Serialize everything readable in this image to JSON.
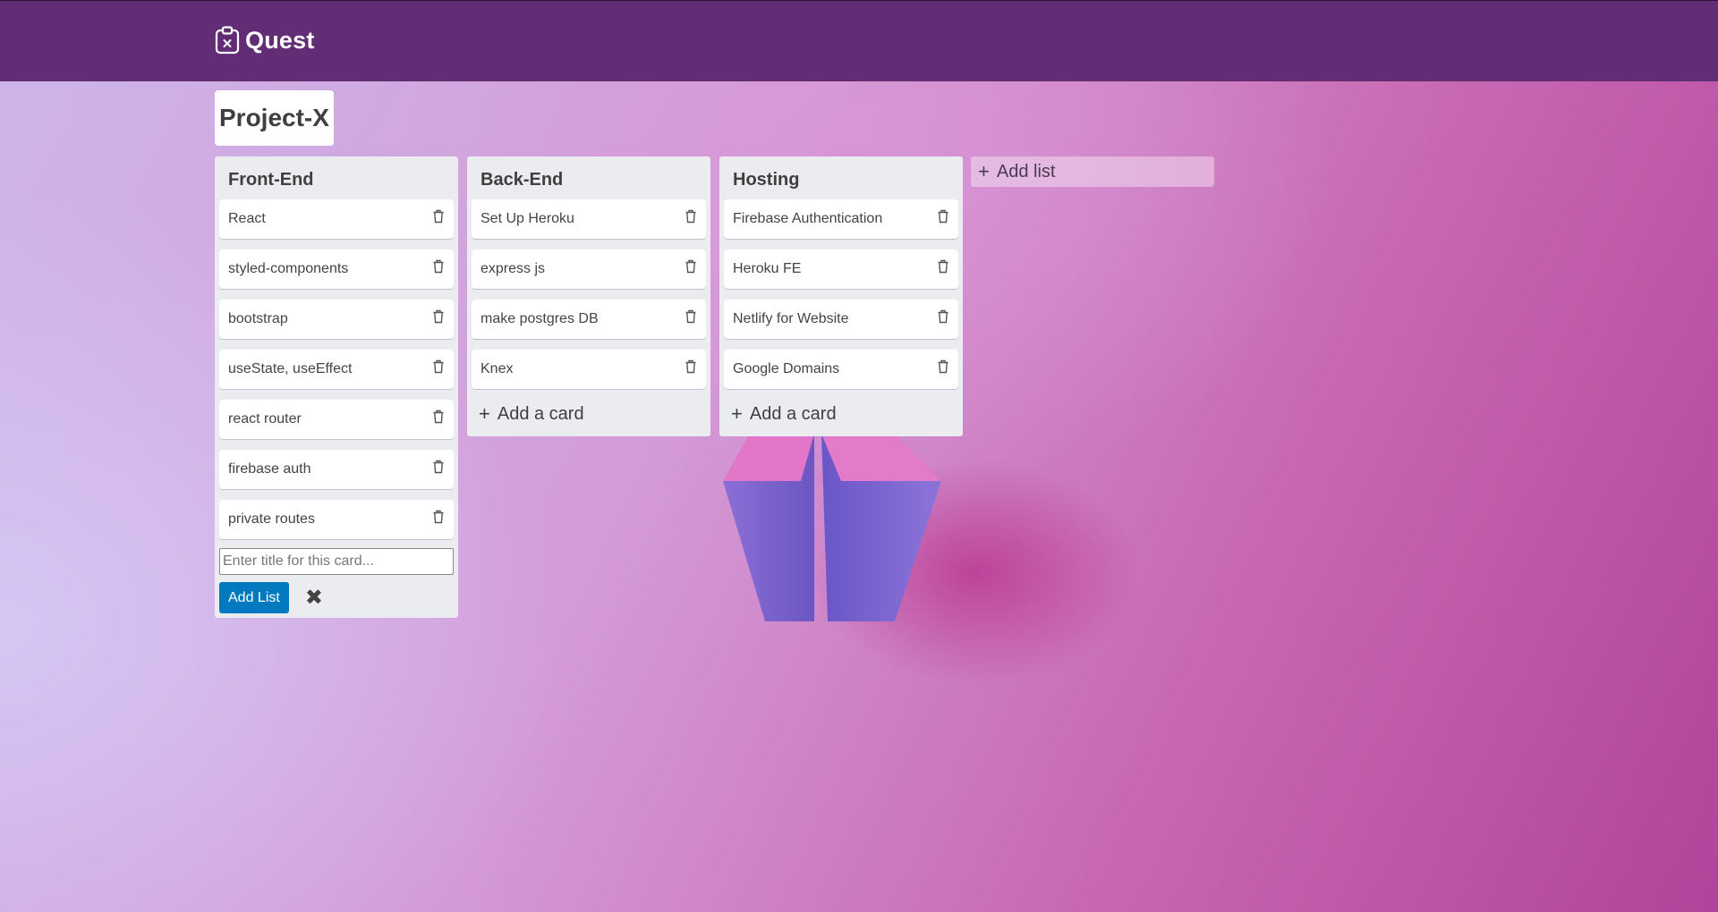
{
  "app": {
    "name": "Quest",
    "logo_icon": "clipboard-x-icon"
  },
  "board": {
    "title": "Project-X"
  },
  "lists": [
    {
      "title": "Front-End",
      "cards": [
        "React",
        "styled-components",
        "bootstrap",
        "useState, useEffect",
        "react router",
        "firebase auth",
        "private routes"
      ],
      "composer": {
        "placeholder": "Enter title for this card...",
        "value": "",
        "submit_label": "Add List",
        "close_icon": "close-icon"
      }
    },
    {
      "title": "Back-End",
      "cards": [
        "Set Up Heroku",
        "express js",
        "make postgres DB",
        "Knex"
      ],
      "add_card_label": "Add a card"
    },
    {
      "title": "Hosting",
      "cards": [
        "Firebase Authentication",
        "Heroku FE",
        "Netlify for Website",
        "Google Domains"
      ],
      "add_card_label": "Add a card"
    }
  ],
  "add_list": {
    "label": "Add list"
  },
  "colors": {
    "topbar": "#622d74",
    "list_bg": "#ebecf0",
    "button_primary": "#0079bf"
  }
}
